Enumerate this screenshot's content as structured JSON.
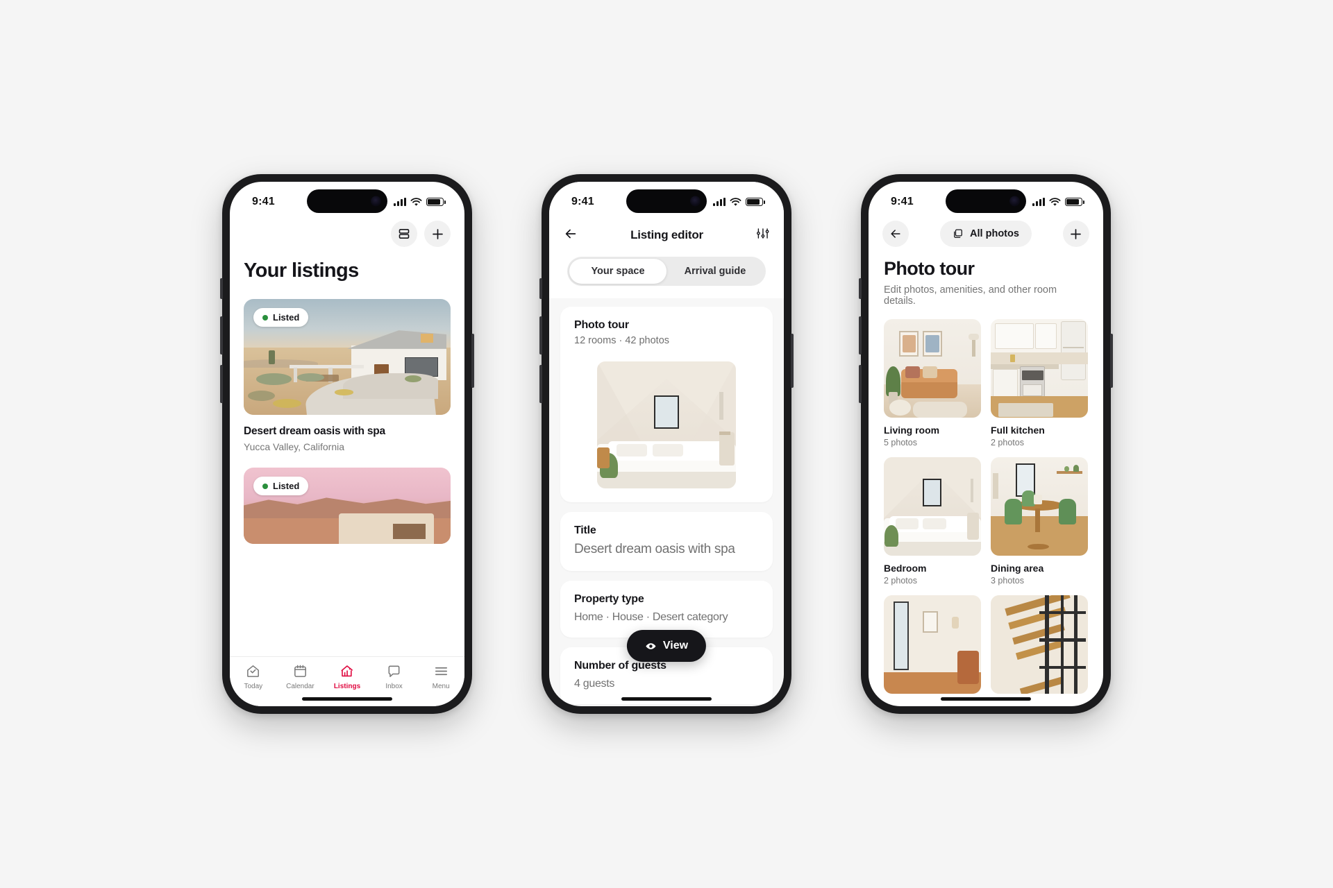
{
  "status_bar": {
    "time": "9:41"
  },
  "phone1": {
    "toolbar": {
      "list_view_icon": "list-view-icon",
      "add_icon": "plus-icon"
    },
    "page_title": "Your listings",
    "listings": [
      {
        "badge": "Listed",
        "name": "Desert dream oasis with spa",
        "location": "Yucca Valley, California",
        "image": "desert-house-photo"
      },
      {
        "badge": "Listed",
        "name": "",
        "location": "",
        "image": "pink-sunset-house-photo"
      }
    ],
    "tabs": [
      {
        "label": "Today",
        "icon": "house-check-icon",
        "active": false
      },
      {
        "label": "Calendar",
        "icon": "calendar-icon",
        "active": false
      },
      {
        "label": "Listings",
        "icon": "house-chart-icon",
        "active": true
      },
      {
        "label": "Inbox",
        "icon": "chat-bubble-icon",
        "active": false
      },
      {
        "label": "Menu",
        "icon": "hamburger-icon",
        "active": false
      }
    ],
    "accent_color": "#e00b41"
  },
  "phone2": {
    "nav": {
      "back_icon": "arrow-left-icon",
      "title": "Listing editor",
      "settings_icon": "sliders-icon"
    },
    "segmented": {
      "options": [
        "Your space",
        "Arrival guide"
      ],
      "selected": "Your space"
    },
    "cards": [
      {
        "heading": "Photo tour",
        "subtitle": "12 rooms · 42 photos",
        "image": "bedroom-attic-photo"
      },
      {
        "heading": "Title",
        "value": "Desert dream oasis with spa"
      },
      {
        "heading": "Property type",
        "value": "Home · House · Desert category"
      },
      {
        "heading": "Number of guests",
        "value": "4 guests"
      }
    ],
    "view_button": {
      "label": "View",
      "icon": "eye-icon"
    }
  },
  "phone3": {
    "nav": {
      "back_icon": "arrow-left-icon",
      "all_photos_label": "All photos",
      "all_photos_icon": "stacked-photos-icon",
      "add_icon": "plus-icon"
    },
    "page_title": "Photo tour",
    "page_subtitle": "Edit photos, amenities, and other room details.",
    "rooms": [
      {
        "name": "Living room",
        "count": "5 photos",
        "image": "living-room-photo"
      },
      {
        "name": "Full kitchen",
        "count": "2 photos",
        "image": "kitchen-photo"
      },
      {
        "name": "Bedroom",
        "count": "2 photos",
        "image": "bedroom-photo"
      },
      {
        "name": "Dining area",
        "count": "3 photos",
        "image": "dining-area-photo"
      },
      {
        "name": "",
        "count": "",
        "image": "hallway-photo"
      },
      {
        "name": "",
        "count": "",
        "image": "staircase-photo"
      }
    ]
  }
}
